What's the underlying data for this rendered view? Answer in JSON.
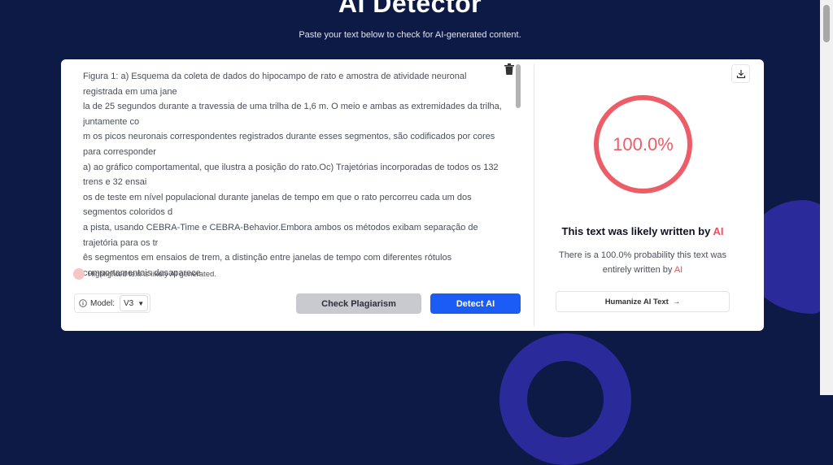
{
  "header": {
    "title": "AI Detector",
    "subtitle": "Paste your text below to check for AI-generated content."
  },
  "editor": {
    "lines": [
      "Figura 1: a) Esquema da coleta de dados do hipocampo de rato e amostra de atividade neuronal registrada em uma jane",
      "la de 25 segundos durante a travessia de uma trilha de 1,6 m. O meio e ambas as extremidades da trilha, juntamente co",
      "m os picos neuronais correspondentes registrados durante esses segmentos, são codificados por cores para corresponder",
      "a) ao gráfico comportamental, que ilustra a posição do rato.Oc) Trajetórias incorporadas de todos os 132 trens e 32 ensai",
      "os de teste em nível populacional durante janelas de tempo em que o rato percorreu cada um dos segmentos coloridos d",
      "a pista, usando CEBRA-Time e CEBRA-Behavior.Embora ambos os métodos exibam separação de trajetória para os tr",
      "ês segmentos em ensaios de trem, a distinção entre janelas de tempo com diferentes rótulos",
      "comportamentais desaparece"
    ],
    "overlay_message": "Highlighted text is likely AI generated."
  },
  "controls": {
    "model_label": "Model:",
    "model_value": "V3",
    "plagiarism_button": "Check Plagiarism",
    "detect_button": "Detect AI"
  },
  "result": {
    "score": "100.0%",
    "verdict_prefix": "This text was likely written by ",
    "verdict_accent": "AI",
    "detail_prefix": "There is a 100.0% probability this text was entirely written by ",
    "detail_accent": "AI",
    "humanize_button": "Humanize AI Text",
    "humanize_arrow": "→"
  },
  "colors": {
    "background": "#0d1a45",
    "accent_red": "#ec5d68",
    "primary_blue": "#1a5cf5",
    "decor_purple": "#2a2a9a"
  }
}
